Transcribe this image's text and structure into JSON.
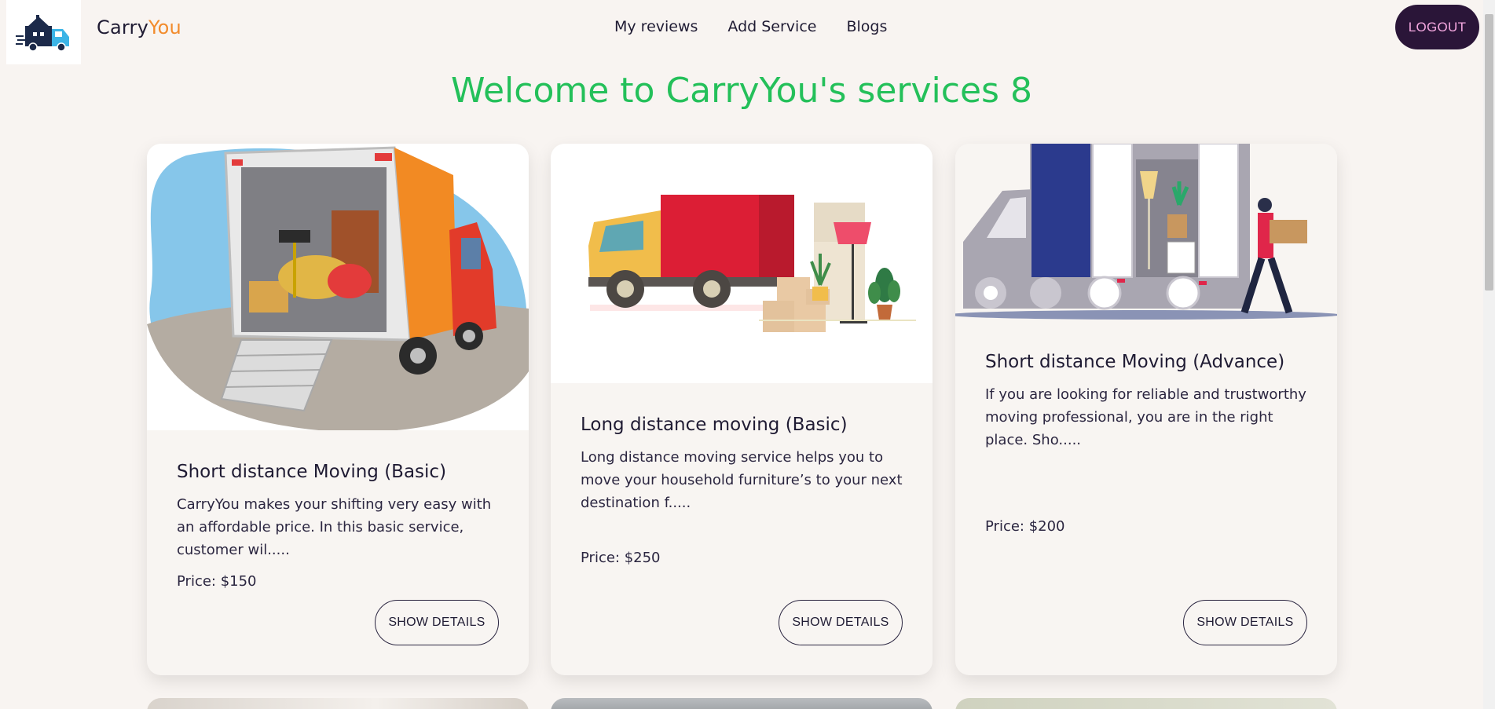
{
  "brand": {
    "name_part1": "Carry",
    "name_part2": "You"
  },
  "nav": {
    "links": [
      "My reviews",
      "Add Service",
      "Blogs"
    ],
    "logout_label": "LOGOUT"
  },
  "heading": "Welcome to CarryYou's services 8",
  "services": [
    {
      "title": "Short distance Moving (Basic)",
      "description": "CarryYou makes your shifting very easy with an affordable price. In this basic service, customer wil.....",
      "price": "Price: $150",
      "button_label": "SHOW DETAILS"
    },
    {
      "title": "Long distance moving (Basic)",
      "description": "Long distance moving service helps you to move your household furniture’s to your next destination f.....",
      "price": "Price: $250",
      "button_label": "SHOW DETAILS"
    },
    {
      "title": "Short distance Moving (Advance)",
      "description": "If you are looking for reliable and trustworthy moving professional, you are in the right place. Sho.....",
      "price": "Price: $200",
      "button_label": "SHOW DETAILS"
    }
  ],
  "colors": {
    "accent_green": "#24c05a",
    "brand_orange": "#f28b2c",
    "logout_bg": "#2a1538",
    "background": "#f8f4f1"
  }
}
